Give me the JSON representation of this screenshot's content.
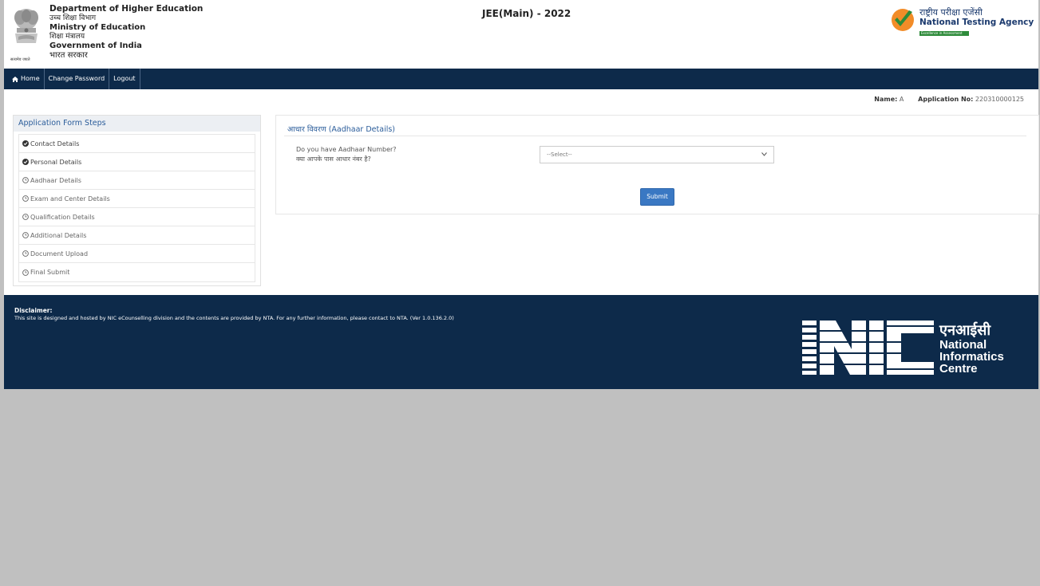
{
  "header": {
    "emblem_caption": "सत्यमेव जयते",
    "dept_lines": [
      {
        "text": "Department of Higher Education",
        "lang": "en"
      },
      {
        "text": "उच्च शिक्षा विभाग",
        "lang": "hi"
      },
      {
        "text": "Ministry of Education",
        "lang": "en"
      },
      {
        "text": "शिक्षा मंत्रालय",
        "lang": "hi"
      },
      {
        "text": "Government of India",
        "lang": "en"
      },
      {
        "text": "भारत सरकार",
        "lang": "hi"
      }
    ],
    "site_title": "JEE(Main) - 2022",
    "nta_hindi": "राष्ट्रीय परीक्षा एजेंसी",
    "nta_english": "National Testing Agency",
    "nta_tagline": "Excellence in Assessment",
    "colors": {
      "nta_orange": "#f28c28",
      "nta_green": "#2e8b3a",
      "nta_blue": "#1b3a6e"
    }
  },
  "navbar": {
    "items": [
      {
        "label": "Home",
        "icon": "home-icon"
      },
      {
        "label": "Change Password"
      },
      {
        "label": "Logout"
      }
    ],
    "color": "#0d2a4a"
  },
  "user": {
    "name_label": "Name:",
    "name_value": "A",
    "app_label": "Application No:",
    "app_value": "220310000125"
  },
  "sidebar": {
    "title": "Application Form Steps",
    "steps": [
      {
        "label": "Contact Details",
        "status": "done"
      },
      {
        "label": "Personal Details",
        "status": "done"
      },
      {
        "label": "Aadhaar Details",
        "status": "pending"
      },
      {
        "label": "Exam and Center Details",
        "status": "pending"
      },
      {
        "label": "Qualification Details",
        "status": "pending"
      },
      {
        "label": "Additional Details",
        "status": "pending"
      },
      {
        "label": "Document Upload",
        "status": "pending"
      },
      {
        "label": "Final Submit",
        "status": "pending"
      }
    ]
  },
  "main": {
    "title": "आधार विवरण (Aadhaar Details)",
    "question_en": "Do you have Aadhaar Number?",
    "question_hi": "क्या आपके पास आधार नंबर है?",
    "select_value": "--Select--",
    "submit_label": "Submit"
  },
  "footer": {
    "disclaimer_title": "Disclaimer:",
    "disclaimer_text": "This site is designed and hosted by NIC eCounselling division and the contents are provided by NTA. For any further information, please contact to NTA. (Ver 1.0.136.2.0)",
    "nic_hindi": "एनआईसी",
    "nic_en_1": "National",
    "nic_en_2": "Informatics",
    "nic_en_3": "Centre"
  }
}
